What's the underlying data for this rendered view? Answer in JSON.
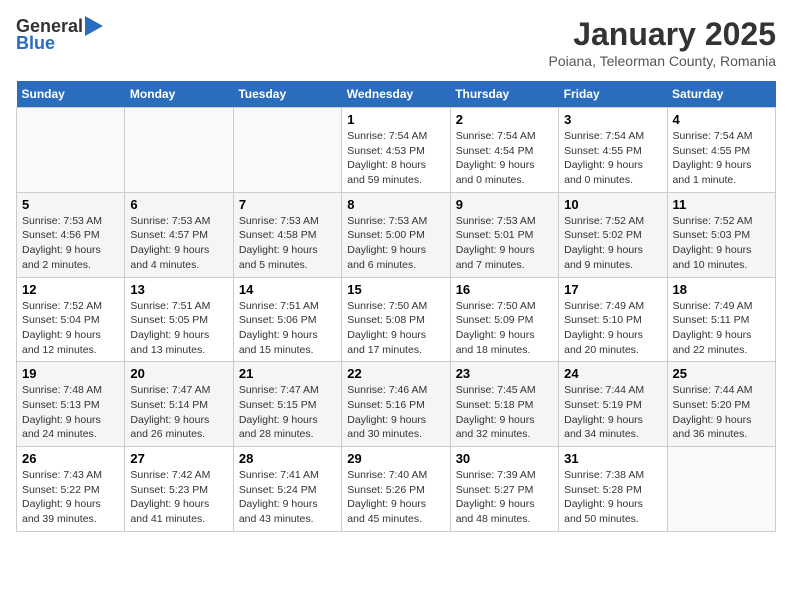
{
  "logo": {
    "general": "General",
    "blue": "Blue"
  },
  "title": "January 2025",
  "location": "Poiana, Teleorman County, Romania",
  "days_of_week": [
    "Sunday",
    "Monday",
    "Tuesday",
    "Wednesday",
    "Thursday",
    "Friday",
    "Saturday"
  ],
  "weeks": [
    [
      {
        "day": "",
        "info": ""
      },
      {
        "day": "",
        "info": ""
      },
      {
        "day": "",
        "info": ""
      },
      {
        "day": "1",
        "info": "Sunrise: 7:54 AM\nSunset: 4:53 PM\nDaylight: 8 hours and 59 minutes."
      },
      {
        "day": "2",
        "info": "Sunrise: 7:54 AM\nSunset: 4:54 PM\nDaylight: 9 hours and 0 minutes."
      },
      {
        "day": "3",
        "info": "Sunrise: 7:54 AM\nSunset: 4:55 PM\nDaylight: 9 hours and 0 minutes."
      },
      {
        "day": "4",
        "info": "Sunrise: 7:54 AM\nSunset: 4:55 PM\nDaylight: 9 hours and 1 minute."
      }
    ],
    [
      {
        "day": "5",
        "info": "Sunrise: 7:53 AM\nSunset: 4:56 PM\nDaylight: 9 hours and 2 minutes."
      },
      {
        "day": "6",
        "info": "Sunrise: 7:53 AM\nSunset: 4:57 PM\nDaylight: 9 hours and 4 minutes."
      },
      {
        "day": "7",
        "info": "Sunrise: 7:53 AM\nSunset: 4:58 PM\nDaylight: 9 hours and 5 minutes."
      },
      {
        "day": "8",
        "info": "Sunrise: 7:53 AM\nSunset: 5:00 PM\nDaylight: 9 hours and 6 minutes."
      },
      {
        "day": "9",
        "info": "Sunrise: 7:53 AM\nSunset: 5:01 PM\nDaylight: 9 hours and 7 minutes."
      },
      {
        "day": "10",
        "info": "Sunrise: 7:52 AM\nSunset: 5:02 PM\nDaylight: 9 hours and 9 minutes."
      },
      {
        "day": "11",
        "info": "Sunrise: 7:52 AM\nSunset: 5:03 PM\nDaylight: 9 hours and 10 minutes."
      }
    ],
    [
      {
        "day": "12",
        "info": "Sunrise: 7:52 AM\nSunset: 5:04 PM\nDaylight: 9 hours and 12 minutes."
      },
      {
        "day": "13",
        "info": "Sunrise: 7:51 AM\nSunset: 5:05 PM\nDaylight: 9 hours and 13 minutes."
      },
      {
        "day": "14",
        "info": "Sunrise: 7:51 AM\nSunset: 5:06 PM\nDaylight: 9 hours and 15 minutes."
      },
      {
        "day": "15",
        "info": "Sunrise: 7:50 AM\nSunset: 5:08 PM\nDaylight: 9 hours and 17 minutes."
      },
      {
        "day": "16",
        "info": "Sunrise: 7:50 AM\nSunset: 5:09 PM\nDaylight: 9 hours and 18 minutes."
      },
      {
        "day": "17",
        "info": "Sunrise: 7:49 AM\nSunset: 5:10 PM\nDaylight: 9 hours and 20 minutes."
      },
      {
        "day": "18",
        "info": "Sunrise: 7:49 AM\nSunset: 5:11 PM\nDaylight: 9 hours and 22 minutes."
      }
    ],
    [
      {
        "day": "19",
        "info": "Sunrise: 7:48 AM\nSunset: 5:13 PM\nDaylight: 9 hours and 24 minutes."
      },
      {
        "day": "20",
        "info": "Sunrise: 7:47 AM\nSunset: 5:14 PM\nDaylight: 9 hours and 26 minutes."
      },
      {
        "day": "21",
        "info": "Sunrise: 7:47 AM\nSunset: 5:15 PM\nDaylight: 9 hours and 28 minutes."
      },
      {
        "day": "22",
        "info": "Sunrise: 7:46 AM\nSunset: 5:16 PM\nDaylight: 9 hours and 30 minutes."
      },
      {
        "day": "23",
        "info": "Sunrise: 7:45 AM\nSunset: 5:18 PM\nDaylight: 9 hours and 32 minutes."
      },
      {
        "day": "24",
        "info": "Sunrise: 7:44 AM\nSunset: 5:19 PM\nDaylight: 9 hours and 34 minutes."
      },
      {
        "day": "25",
        "info": "Sunrise: 7:44 AM\nSunset: 5:20 PM\nDaylight: 9 hours and 36 minutes."
      }
    ],
    [
      {
        "day": "26",
        "info": "Sunrise: 7:43 AM\nSunset: 5:22 PM\nDaylight: 9 hours and 39 minutes."
      },
      {
        "day": "27",
        "info": "Sunrise: 7:42 AM\nSunset: 5:23 PM\nDaylight: 9 hours and 41 minutes."
      },
      {
        "day": "28",
        "info": "Sunrise: 7:41 AM\nSunset: 5:24 PM\nDaylight: 9 hours and 43 minutes."
      },
      {
        "day": "29",
        "info": "Sunrise: 7:40 AM\nSunset: 5:26 PM\nDaylight: 9 hours and 45 minutes."
      },
      {
        "day": "30",
        "info": "Sunrise: 7:39 AM\nSunset: 5:27 PM\nDaylight: 9 hours and 48 minutes."
      },
      {
        "day": "31",
        "info": "Sunrise: 7:38 AM\nSunset: 5:28 PM\nDaylight: 9 hours and 50 minutes."
      },
      {
        "day": "",
        "info": ""
      }
    ]
  ]
}
